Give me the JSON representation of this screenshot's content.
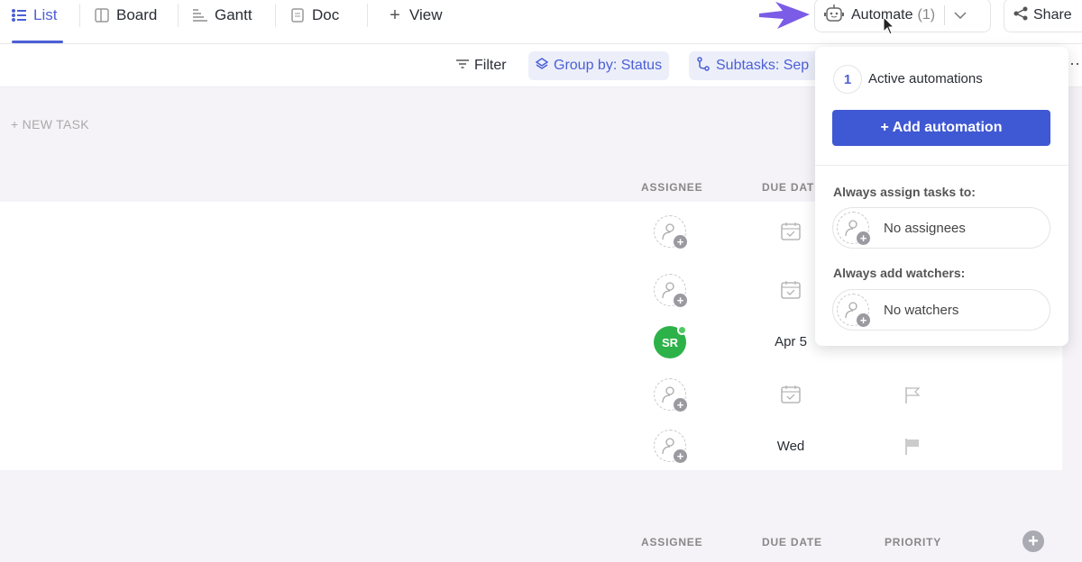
{
  "tabs": [
    {
      "label": "List",
      "icon": "list-icon",
      "active": true
    },
    {
      "label": "Board",
      "icon": "board-icon"
    },
    {
      "label": "Gantt",
      "icon": "gantt-icon"
    },
    {
      "label": "Doc",
      "icon": "doc-icon"
    },
    {
      "label": "View",
      "icon": "plus-icon"
    }
  ],
  "header": {
    "automate_label": "Automate",
    "automate_count": "(1)",
    "share_label": "Share"
  },
  "toolbar": {
    "filter": "Filter",
    "group_by": "Group by: Status",
    "subtasks": "Subtasks: Sep"
  },
  "list": {
    "new_task": "+ NEW TASK",
    "columns": {
      "assignee": "ASSIGNEE",
      "due_date": "DUE DAT",
      "priority": "PRIORITY"
    },
    "rows": [
      {
        "assignee": "",
        "due": ""
      },
      {
        "assignee": "",
        "due": ""
      },
      {
        "assignee": "SR",
        "due": "Apr 5"
      },
      {
        "assignee": "",
        "due": ""
      },
      {
        "assignee": "",
        "due": "Wed"
      }
    ],
    "group2_columns": {
      "assignee": "ASSIGNEE",
      "due_date": "DUE DATE",
      "priority": "PRIORITY"
    }
  },
  "popup": {
    "count": "1",
    "title": "Active automations",
    "add_button": "+ Add automation",
    "assign_label": "Always assign tasks to:",
    "assign_value": "No assignees",
    "watchers_label": "Always add watchers:",
    "watchers_value": "No watchers"
  },
  "colors": {
    "accent": "#4c5fd5",
    "button": "#3f58d3",
    "avatar_sr": "#2db24a",
    "arrow": "#7b5ce6"
  }
}
